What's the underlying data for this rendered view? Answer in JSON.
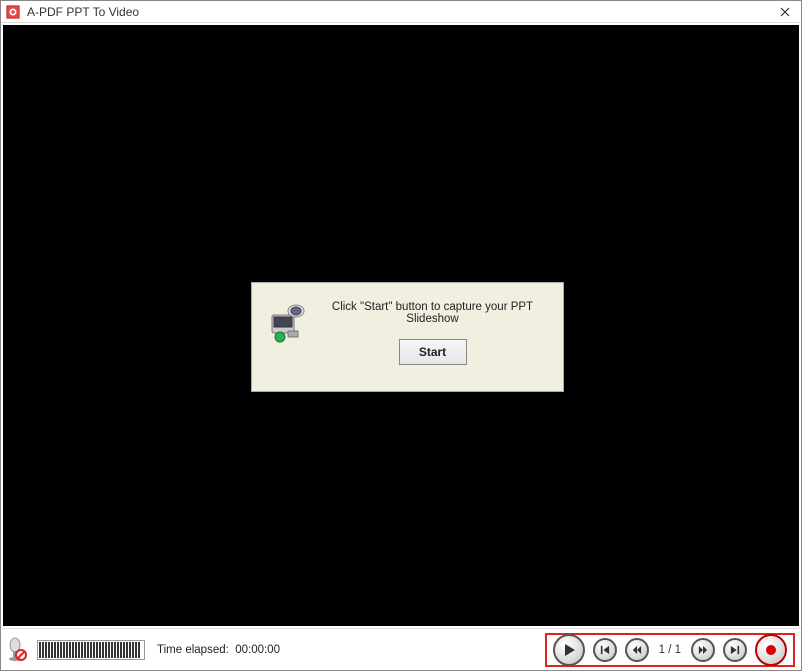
{
  "window": {
    "title": "A-PDF PPT To Video"
  },
  "dialog": {
    "message": "Click \"Start\" button to capture your PPT Slideshow",
    "start_label": "Start"
  },
  "footer": {
    "time_label": "Time elapsed:",
    "time_value": "00:00:00",
    "page_counter": "1 / 1"
  }
}
